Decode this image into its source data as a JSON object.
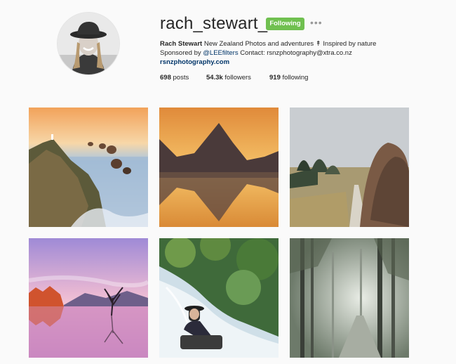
{
  "profile": {
    "username": "rach_stewart_nz",
    "follow_label": "Following",
    "more_label": "•••",
    "display_name": "Rach Stewart",
    "bio_text": "New Zealand Photos and adventures ↟ Inspired by nature",
    "sponsor_prefix": "Sponsored by",
    "sponsor_handle": "@LEEfilters",
    "contact_text": "Contact: rsnzphotography@xtra.co.nz",
    "website": "rsnzphotography.com"
  },
  "stats": {
    "posts_count": "698",
    "posts_label": "posts",
    "followers_count": "54.3k",
    "followers_label": "followers",
    "following_count": "919",
    "following_label": "following"
  },
  "photos": [
    {
      "subject": "coastal cliffs with lighthouse at sunrise"
    },
    {
      "subject": "mountain peak reflected in lake at sunset"
    },
    {
      "subject": "autumn trees along a road"
    },
    {
      "subject": "lone tree in lake at pink dusk"
    },
    {
      "subject": "person in hat sitting by waterfall"
    },
    {
      "subject": "misty forest road"
    }
  ],
  "colors": {
    "follow_green": "#70c050",
    "link_blue": "#003569",
    "background": "#fafafa"
  }
}
